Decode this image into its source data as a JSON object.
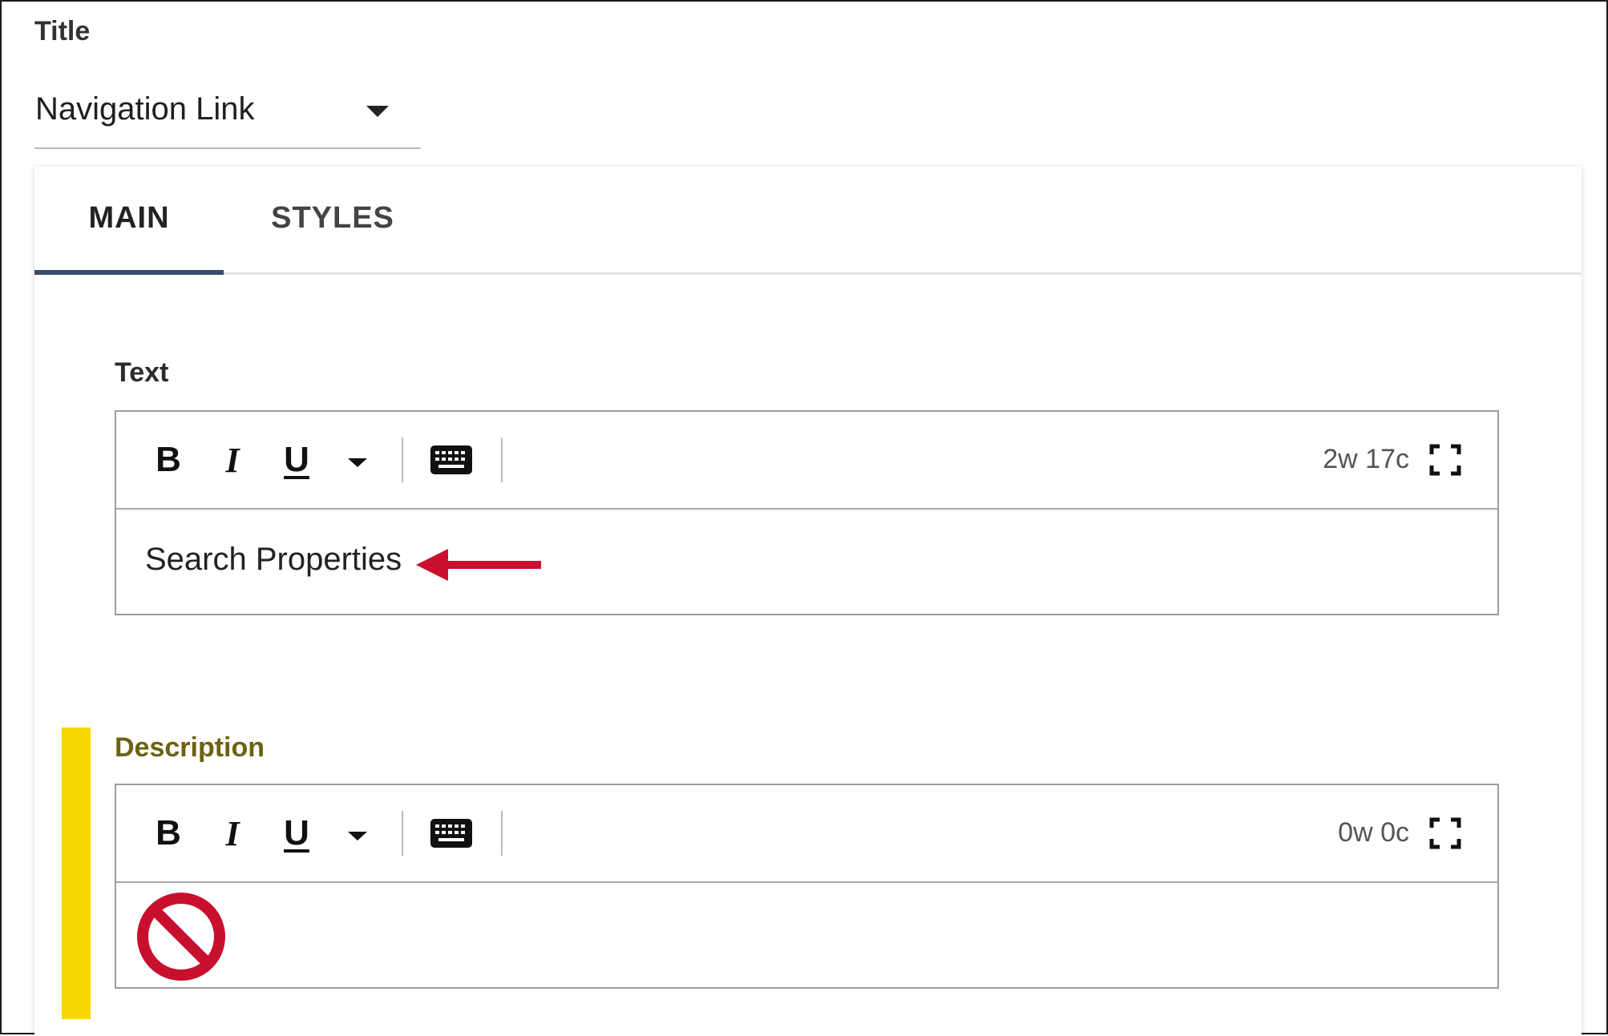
{
  "title_field": {
    "label": "Title",
    "value": "Navigation Link"
  },
  "tabs": [
    {
      "label": "MAIN",
      "active": true
    },
    {
      "label": "STYLES",
      "active": false
    }
  ],
  "text_field": {
    "label": "Text",
    "toolbar": {
      "bold": "B",
      "italic": "I",
      "underline": "U",
      "counter": "2w 17c"
    },
    "content": "Search Properties"
  },
  "description_field": {
    "label": "Description",
    "toolbar": {
      "bold": "B",
      "italic": "I",
      "underline": "U",
      "counter": "0w 0c"
    },
    "content": ""
  },
  "colors": {
    "tab_underline": "#3a4a6b",
    "annotation_arrow": "#c8102e",
    "highlight_bar": "#f7d800",
    "description_label": "#6d6211",
    "prohibited_icon": "#c8102e"
  },
  "icons": [
    "caret-down-icon",
    "keyboard-icon",
    "fullscreen-icon",
    "arrow-left-icon",
    "prohibited-icon"
  ]
}
